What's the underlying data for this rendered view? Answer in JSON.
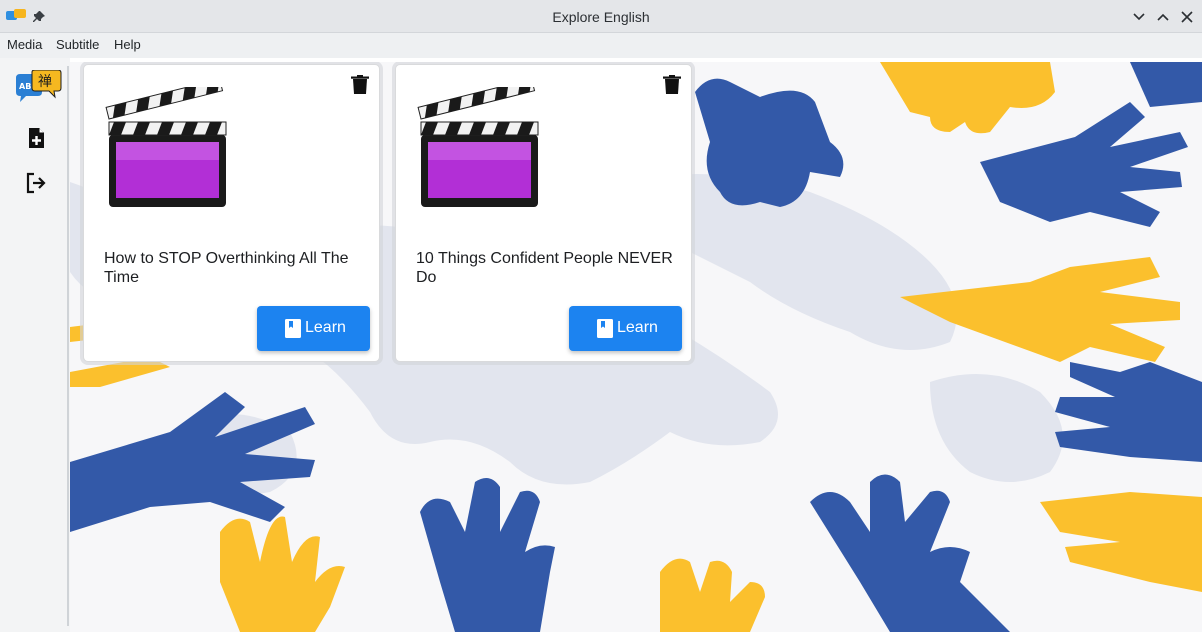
{
  "window": {
    "title": "Explore English",
    "icons": [
      "app-logo-icon",
      "pin-icon",
      "minimize-icon",
      "maximize-icon",
      "close-icon"
    ]
  },
  "menubar": {
    "items": [
      {
        "label": "Media"
      },
      {
        "label": "Subtitle"
      },
      {
        "label": "Help"
      }
    ]
  },
  "sidebar": {
    "logo": {
      "ab_text": "AB",
      "zh_text": "禅"
    },
    "buttons": [
      {
        "icon": "add-file-icon"
      },
      {
        "icon": "logout-icon"
      }
    ]
  },
  "cards": [
    {
      "title": "How to STOP Overthinking All The Time",
      "button_label": "Learn",
      "thumbnail": "movie-clapperboard-icon"
    },
    {
      "title": "10 Things Confident People NEVER Do",
      "button_label": "Learn",
      "thumbnail": "movie-clapperboard-icon"
    }
  ],
  "colors": {
    "accent": "#1c83f0",
    "hand_blue": "#3359a8",
    "hand_yellow": "#fbc02d",
    "map_grey": "#e2e5ee"
  }
}
